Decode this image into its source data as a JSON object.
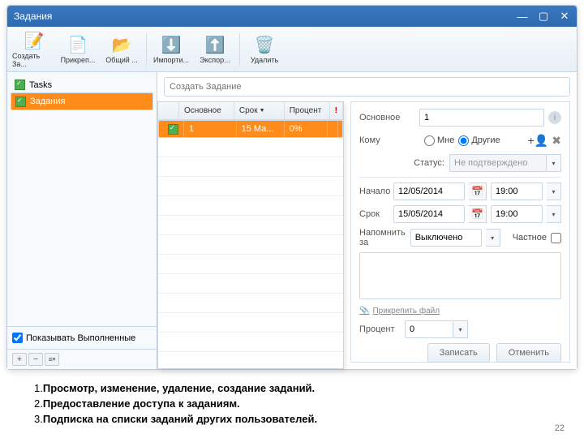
{
  "window": {
    "title": "Задания"
  },
  "toolbar": {
    "create": "Создать За...",
    "attach": "Прикреп...",
    "shared": "Общий ...",
    "import": "Импорти...",
    "export": "Экспор...",
    "delete": "Удалить"
  },
  "sidebar": {
    "items": [
      {
        "label": "Tasks"
      },
      {
        "label": "Задания"
      }
    ],
    "show_completed": "Показывать Выполненные"
  },
  "newtask": {
    "placeholder": "Создать Задание"
  },
  "table": {
    "headers": {
      "main": "Основное",
      "due": "Срок",
      "pct": "Процент",
      "alert": "!"
    },
    "sort_indicator": "▼",
    "rows": [
      {
        "main": "1",
        "due": "15 Ма...",
        "pct": "0%"
      }
    ]
  },
  "detail": {
    "labels": {
      "main": "Основное",
      "to": "Кому",
      "status": "Статус:",
      "start": "Начало",
      "due": "Срок",
      "remind": "Напомнить за",
      "private": "Частное",
      "attach": "Прикрепить файл",
      "pct": "Процент"
    },
    "main_value": "1",
    "radio_me": "Мне",
    "radio_others": "Другие",
    "status_value": "Не подтверждено",
    "start_date": "12/05/2014",
    "start_time": "19:00",
    "due_date": "15/05/2014",
    "due_time": "19:00",
    "remind_value": "Выключено",
    "pct_value": "0",
    "btn_save": "Записать",
    "btn_cancel": "Отменить"
  },
  "bullets": {
    "l1a": "1.",
    "l1b": "Просмотр, изменение, удаление, создание заданий.",
    "l2a": "2.",
    "l2b": "Предоставление доступа к заданиям.",
    "l3a": "3.",
    "l3b": "Подписка на списки заданий других пользователей."
  },
  "page_number": "22"
}
